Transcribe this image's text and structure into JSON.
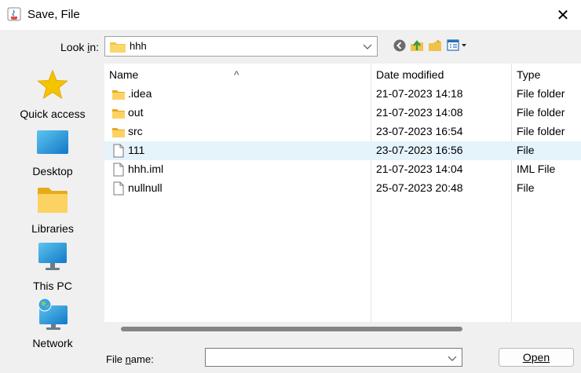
{
  "window": {
    "title": "Save, File",
    "close_glyph": "✕"
  },
  "lookin": {
    "label": "Look in:",
    "value": "hhh"
  },
  "toolbar": {
    "icons": [
      "back-icon",
      "up-one-level-icon",
      "new-folder-icon",
      "view-menu-icon"
    ]
  },
  "sidebar": {
    "items": [
      {
        "label": "Quick access",
        "icon": "star-icon"
      },
      {
        "label": "Desktop",
        "icon": "desktop-icon"
      },
      {
        "label": "Libraries",
        "icon": "libraries-icon"
      },
      {
        "label": "This PC",
        "icon": "this-pc-icon"
      },
      {
        "label": "Network",
        "icon": "network-icon"
      }
    ]
  },
  "table": {
    "headers": {
      "name": "Name",
      "date": "Date modified",
      "type": "Type"
    },
    "rows": [
      {
        "name": ".idea",
        "date": "21-07-2023 14:18",
        "type": "File folder",
        "icon": "folder-icon",
        "selected": false
      },
      {
        "name": "out",
        "date": "21-07-2023 14:08",
        "type": "File folder",
        "icon": "folder-icon",
        "selected": false
      },
      {
        "name": "src",
        "date": "23-07-2023 16:54",
        "type": "File folder",
        "icon": "folder-icon",
        "selected": false
      },
      {
        "name": "111",
        "date": "23-07-2023 16:56",
        "type": "File",
        "icon": "file-icon",
        "selected": true
      },
      {
        "name": "hhh.iml",
        "date": "21-07-2023 14:04",
        "type": "IML File",
        "icon": "file-icon",
        "selected": false
      },
      {
        "name": "nullnull",
        "date": "25-07-2023 20:48",
        "type": "File",
        "icon": "file-icon",
        "selected": false
      }
    ]
  },
  "filename": {
    "label": "File name:",
    "value": ""
  },
  "buttons": {
    "open": "Open"
  },
  "colors": {
    "selection": "#e5f3fb",
    "folder": "#f7c442",
    "accent": "#0078d4"
  }
}
